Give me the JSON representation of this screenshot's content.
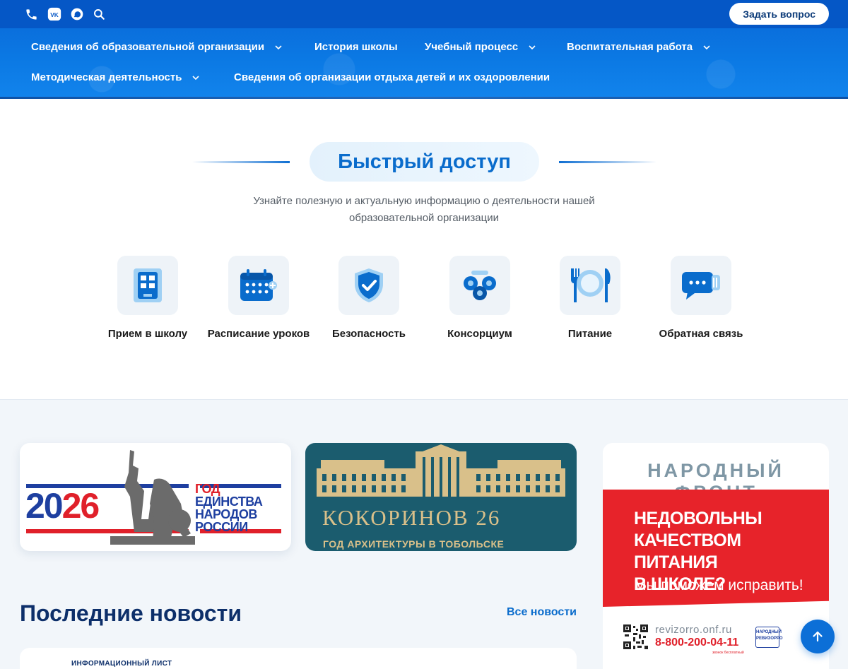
{
  "header": {
    "ask_button": "Задать вопрос",
    "top_icons": [
      "phone-icon",
      "vk-icon",
      "chat-icon",
      "search-icon"
    ],
    "nav": [
      {
        "label": "Сведения об образовательной организации",
        "dropdown": true
      },
      {
        "label": "История школы",
        "dropdown": false
      },
      {
        "label": "Учебный процесс",
        "dropdown": true
      },
      {
        "label": "Воспитательная работа",
        "dropdown": true
      },
      {
        "label": "Методическая деятельность",
        "dropdown": true
      },
      {
        "label": "Сведения об организации отдыха детей и их оздоровлении",
        "dropdown": false
      }
    ],
    "colors": {
      "topbar": "#0557c6",
      "nav_bg": "#0b79e4"
    }
  },
  "quick_access": {
    "title": "Быстрый доступ",
    "subtitle": "Узнайте полезную и актуальную информацию о деятельности нашей образовательной организации",
    "items": [
      {
        "label": "Прием в школу",
        "icon": "school-building-icon"
      },
      {
        "label": "Расписание уроков",
        "icon": "calendar-icon"
      },
      {
        "label": "Безопасность",
        "icon": "shield-check-icon"
      },
      {
        "label": "Консорциум",
        "icon": "consortium-icon"
      },
      {
        "label": "Питание",
        "icon": "plate-cutlery-icon"
      },
      {
        "label": "Обратная связь",
        "icon": "feedback-chat-icon"
      }
    ],
    "colors": {
      "accent": "#0a6ccc",
      "tile_bg": "#eef3f8"
    }
  },
  "banners": {
    "unity": {
      "year_a": "20",
      "year_b": "26",
      "line1": "ГОД",
      "line2": "ЕДИНСТВА",
      "line3": "НАРОДОВ",
      "line4": "РОССИИ"
    },
    "architecture": {
      "title": "КОКОРИНОВ 26",
      "subtitle": "ГОД АРХИТЕКТУРЫ В ТОБОЛЬСКЕ"
    },
    "front": {
      "head": "НАРОДНЫЙ ФРОНТ",
      "main_1": "НЕДОВОЛЬНЫ",
      "main_2": "КАЧЕСТВОМ ПИТАНИЯ",
      "main_3": "В ШКОЛЕ?",
      "help": "Мы поможем исправить!",
      "url": "revizorro.onf.ru",
      "phone": "8-800-200-04-11",
      "phone_note": "звонок бесплатный",
      "logo_text": "НАРОДНЫЙ РЕВИЗОРРО"
    }
  },
  "news": {
    "title": "Последние новости",
    "all_link": "Все новости",
    "first_card_label": "ИНФОРМАЦИОННЫЙ ЛИСТ"
  }
}
